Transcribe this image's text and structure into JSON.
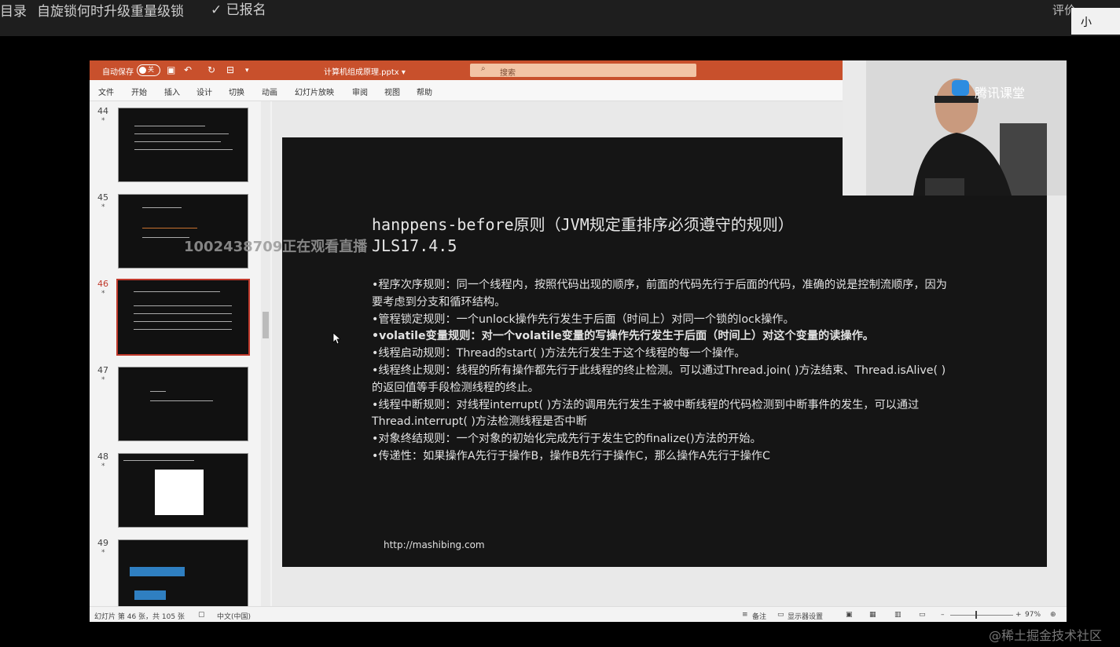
{
  "topbar": {
    "catalog": "目录",
    "course_title": "自旋锁何时升级重量级锁",
    "enrolled": "✓ 已报名",
    "rate": "评价",
    "mini_window": "小"
  },
  "ppt": {
    "autosave_label": "自动保存",
    "autosave_state": "关",
    "filename": "计算机组成原理.pptx ▾",
    "search_placeholder": "搜索",
    "menu": [
      "文件",
      "开始",
      "插入",
      "设计",
      "切换",
      "动画",
      "幻灯片放映",
      "审阅",
      "视图",
      "帮助"
    ],
    "thumbnails": [
      {
        "num": "44",
        "star": "*"
      },
      {
        "num": "45",
        "star": "*"
      },
      {
        "num": "46",
        "star": "*"
      },
      {
        "num": "47",
        "star": "*"
      },
      {
        "num": "48",
        "star": "*"
      },
      {
        "num": "49",
        "star": "*"
      }
    ],
    "slide": {
      "title_line1": "hanppens-before原则（JVM规定重排序必须遵守的规则）",
      "title_line2": "JLS17.4.5",
      "rules": [
        "•程序次序规则：同一个线程内，按照代码出现的顺序，前面的代码先行于后面的代码，准确的说是控制流顺序，因为要考虑到分支和循环结构。",
        "•管程锁定规则：一个unlock操作先行发生于后面（时间上）对同一个锁的lock操作。",
        "•volatile变量规则：对一个volatile变量的写操作先行发生于后面（时间上）对这个变量的读操作。",
        "•线程启动规则：Thread的start( )方法先行发生于这个线程的每一个操作。",
        "•线程终止规则：线程的所有操作都先行于此线程的终止检测。可以通过Thread.join( )方法结束、Thread.isAlive( )的返回值等手段检测线程的终止。",
        "•线程中断规则：对线程interrupt( )方法的调用先行发生于被中断线程的代码检测到中断事件的发生，可以通过Thread.interrupt( )方法检测线程是否中断",
        "•对象终结规则：一个对象的初始化完成先行于发生它的finalize()方法的开始。",
        "•传递性：如果操作A先行于操作B，操作B先行于操作C，那么操作A先行于操作C"
      ],
      "url": "http://mashibing.com"
    },
    "status": {
      "slide_count": "幻灯片 第 46 张，共 105 张",
      "language": "中文(中国)",
      "notes": "备注",
      "display_settings": "显示器设置",
      "zoom": "97%"
    }
  },
  "camera": {
    "brand": "腾讯课堂"
  },
  "overlay": {
    "watching": "1002438709正在观看直播",
    "site_watermark": "@稀土掘金技术社区"
  }
}
